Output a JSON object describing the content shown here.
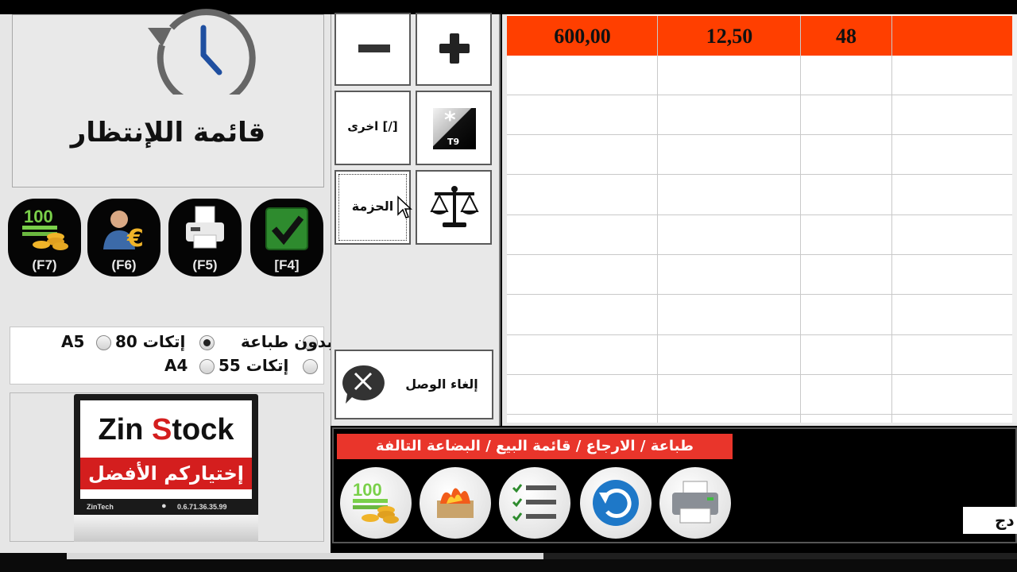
{
  "left_panel": {
    "waitlist_label": "قائمة اللإنتظار",
    "fkeys": [
      {
        "key": "(F7)",
        "icon": "money-coins-icon"
      },
      {
        "key": "(F6)",
        "icon": "user-euro-icon"
      },
      {
        "key": "(F5)",
        "icon": "fax-print-icon"
      },
      {
        "key": "[F4]",
        "icon": "checkmark-icon"
      }
    ],
    "print_options": {
      "no_print": "بدون طباعة",
      "ticket_80": "إتكات 80",
      "ticket_55": "إتكات 55",
      "a5": "A5",
      "a4": "A4",
      "selected": "no_print"
    },
    "logo": {
      "brand_part1": "Zin ",
      "brand_part2": "S",
      "brand_part3": "tock",
      "slogan": "إختياركم الأفضل",
      "company": "ZinTech",
      "phone": "0.6.71.36.35.99"
    }
  },
  "middle_panel": {
    "minus_icon": "minus-icon",
    "plus_icon": "plus-icon",
    "other_label": "اخرى [/]",
    "t9_label": "T9",
    "bundle_label": "الحزمة",
    "scale_icon": "scale-icon",
    "disconnect_label": "إلغاء الوصل"
  },
  "grid": {
    "header_values": [
      "600,00",
      "12,50",
      "48",
      ""
    ],
    "header_color": "#ff3f00"
  },
  "bottom_panel": {
    "title": "طباعة / الارجاع / قائمة البيع / البضاعة التالفة",
    "actions": [
      {
        "name": "money-coins-icon"
      },
      {
        "name": "damaged-goods-fire-icon"
      },
      {
        "name": "checklist-icon"
      },
      {
        "name": "return-icon"
      },
      {
        "name": "printer-icon"
      }
    ],
    "currency": "دج"
  }
}
